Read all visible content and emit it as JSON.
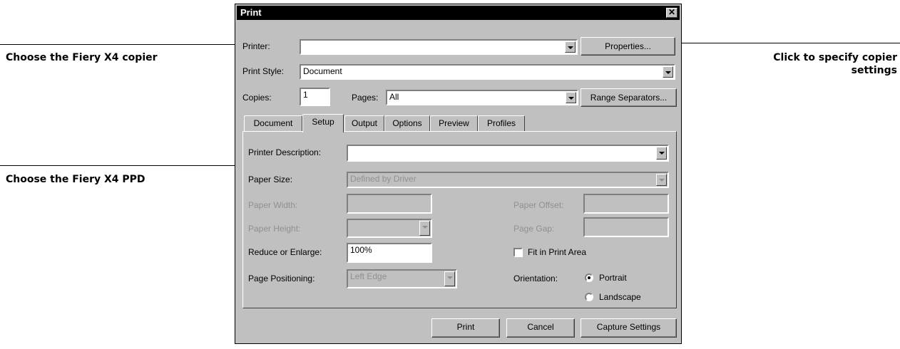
{
  "callouts": {
    "copier": "Choose the Fiery X4 copier",
    "ppd": "Choose the Fiery X4 PPD",
    "settings_line1": "Click to specify copier",
    "settings_line2": "settings"
  },
  "dialog": {
    "title": "Print",
    "printer_label": "Printer:",
    "printer_value": "",
    "properties_button": "Properties...",
    "print_style_label": "Print Style:",
    "print_style_value": "Document",
    "copies_label": "Copies:",
    "copies_value": "1",
    "pages_label": "Pages:",
    "pages_value": "All",
    "range_separators_button": "Range Separators...",
    "tabs": [
      "Document",
      "Setup",
      "Output",
      "Options",
      "Preview",
      "Profiles"
    ],
    "active_tab": "Setup",
    "setup": {
      "printer_description_label": "Printer Description:",
      "printer_description_value": "",
      "paper_size_label": "Paper Size:",
      "paper_size_value": "Defined by Driver",
      "paper_width_label": "Paper Width:",
      "paper_offset_label": "Paper Offset:",
      "paper_height_label": "Paper Height:",
      "page_gap_label": "Page Gap:",
      "reduce_label": "Reduce or Enlarge:",
      "reduce_value": "100%",
      "fit_label": "Fit in Print Area",
      "page_positioning_label": "Page Positioning:",
      "page_positioning_value": "Left Edge",
      "orientation_label": "Orientation:",
      "portrait_label": "Portrait",
      "landscape_label": "Landscape",
      "orientation_selected": "Portrait"
    },
    "buttons": {
      "print": "Print",
      "cancel": "Cancel",
      "capture": "Capture Settings"
    }
  }
}
